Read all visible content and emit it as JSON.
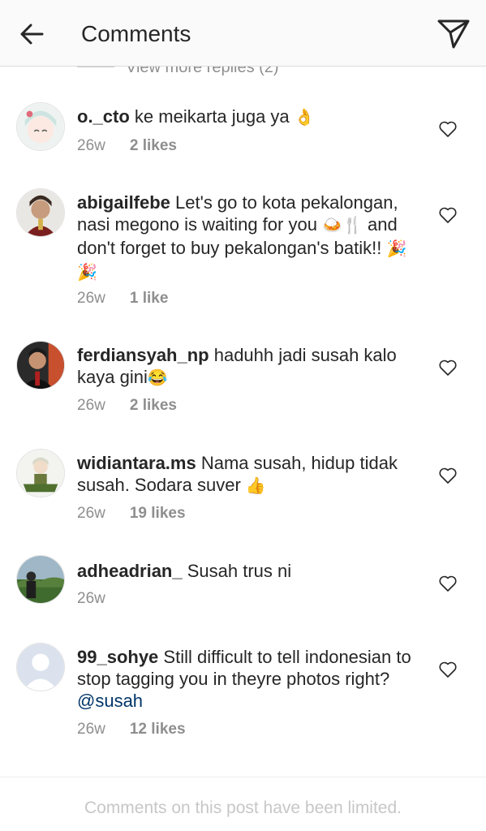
{
  "header": {
    "title": "Comments",
    "back_icon": "arrow-left-icon",
    "send_icon": "paper-plane-icon"
  },
  "view_more_replies": "View more replies (2)",
  "comments": [
    {
      "user": "o._cto",
      "text": " ke meikarta juga ya ",
      "emoji": "👌",
      "time": "26w",
      "likes": "2 likes"
    },
    {
      "user": "abigailfebe",
      "text": " Let's go to kota pekalongan, nasi megono is waiting for you ",
      "emoji": "🍛🍴",
      "text2": " and don't forget to buy pekalongan's batik!! ",
      "emoji2": "🎉🎉",
      "time": "26w",
      "likes": "1 like"
    },
    {
      "user": "ferdiansyah_np",
      "text": " haduhh jadi susah kalo kaya gini",
      "emoji": "😂",
      "time": "26w",
      "likes": "2 likes"
    },
    {
      "user": "widiantara.ms",
      "text": " Nama susah, hidup tidak susah. Sodara suver ",
      "emoji": "👍",
      "time": "26w",
      "likes": "19 likes"
    },
    {
      "user": "adheadrian_",
      "text": " Susah trus ni",
      "time": "26w"
    },
    {
      "user": "99_sohye",
      "text": " Still difficult to tell indonesian to stop tagging you in theyre photos right? ",
      "mention": "@susah",
      "time": "26w",
      "likes": "12 likes"
    }
  ],
  "footer": {
    "notice": "Comments on this post have been limited."
  },
  "colors": {
    "text": "#262626",
    "muted": "#8e8e8e",
    "mention": "#003569",
    "footer_text": "#c7c7c7"
  }
}
